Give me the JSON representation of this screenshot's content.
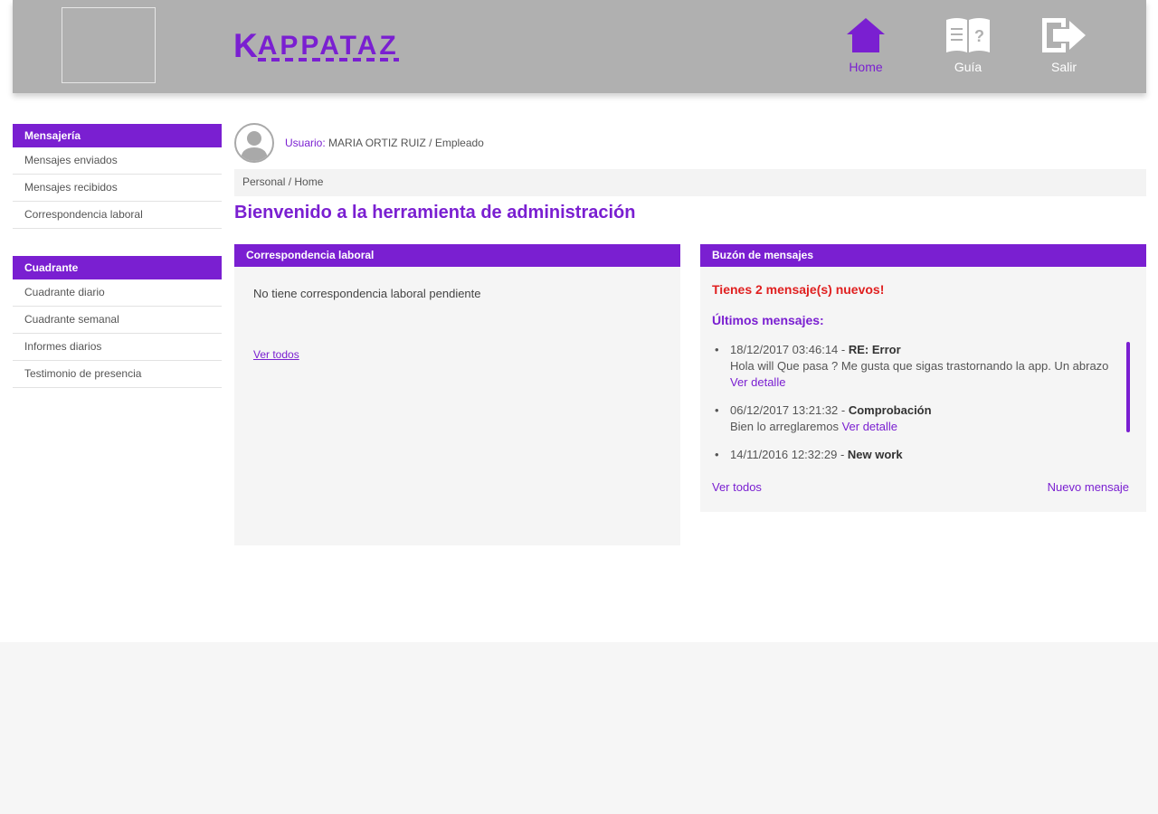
{
  "header": {
    "brand": {
      "k": "K",
      "text": "APPATAZ"
    },
    "nav": [
      {
        "label": "Home",
        "icon": "home-icon",
        "active": true
      },
      {
        "label": "Guía",
        "icon": "book-icon",
        "active": false
      },
      {
        "label": "Salir",
        "icon": "exit-icon",
        "active": false
      }
    ]
  },
  "sidebar": {
    "groups": [
      {
        "title": "Mensajería",
        "items": [
          "Mensajes enviados",
          "Mensajes recibidos",
          "Correspondencia laboral"
        ]
      },
      {
        "title": "Cuadrante",
        "items": [
          "Cuadrante diario",
          "Cuadrante semanal",
          "Informes diarios",
          "Testimonio de presencia"
        ]
      }
    ]
  },
  "user": {
    "label": "Usuario:",
    "value": "MARIA ORTIZ RUIZ / Empleado"
  },
  "breadcrumb": "Personal / Home",
  "page_title": "Bienvenido a la herramienta de administración",
  "correspondence_panel": {
    "title": "Correspondencia laboral",
    "empty_text": "No tiene correspondencia laboral pendiente",
    "view_all": "Ver todos"
  },
  "messages_panel": {
    "title": "Buzón de mensajes",
    "new_count_text": "Tienes 2 mensaje(s) nuevos!",
    "latest_title": "Últimos mensajes:",
    "messages": [
      {
        "date": "18/12/2017 03:46:14",
        "sep": " - ",
        "subject": "RE: Error",
        "body": "Hola will Que pasa ? Me gusta que sigas trastornando la app. Un abrazo",
        "detail": "Ver detalle"
      },
      {
        "date": "06/12/2017 13:21:32",
        "sep": " - ",
        "subject": "Comprobación",
        "body": "Bien lo arreglaremos",
        "detail": "Ver detalle"
      },
      {
        "date": "14/11/2016 12:32:29",
        "sep": " - ",
        "subject": "New work",
        "body": "",
        "detail": ""
      }
    ],
    "view_all": "Ver todos",
    "new_message": "Nuevo mensaje"
  },
  "colors": {
    "accent": "#7a1fd1",
    "header_bg": "#b0b0b0",
    "alert": "#e02020",
    "panel_bg": "#f5f5f5"
  }
}
